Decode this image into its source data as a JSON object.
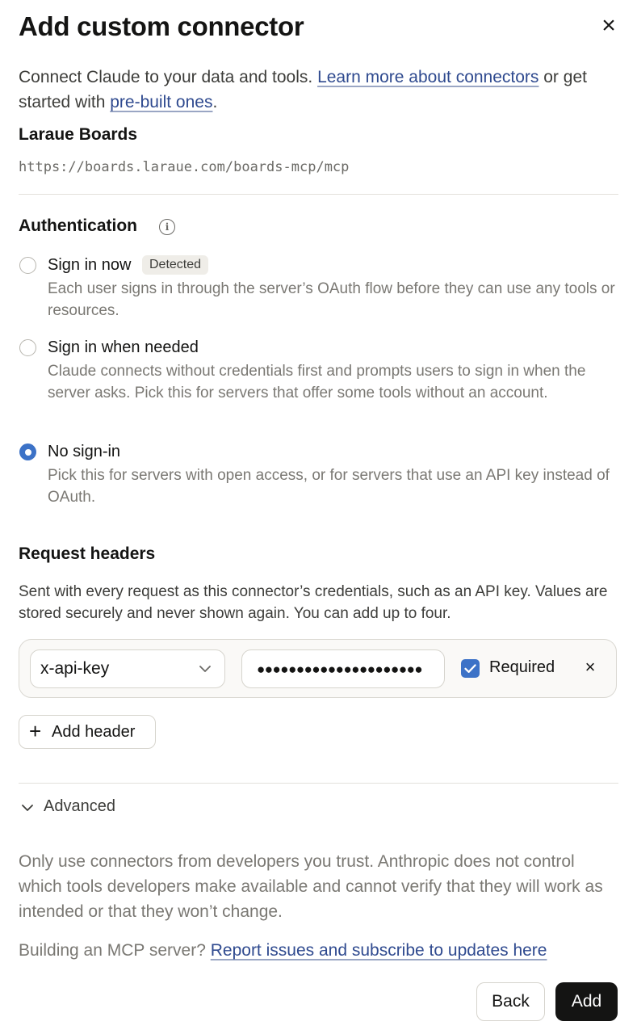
{
  "dialog": {
    "title": "Add custom connector",
    "close_icon": "close-icon"
  },
  "intro": {
    "text_before": "Connect Claude to your data and tools. ",
    "learn_more_link": "Learn more about connectors",
    "text_middle": " or get started with ",
    "prebuilt_link": "pre-built ones",
    "text_after": "."
  },
  "server": {
    "name": "Laraue Boards",
    "url": "https://boards.laraue.com/boards-mcp/mcp"
  },
  "authentication": {
    "title": "Authentication",
    "info_icon": "info-icon",
    "selected": "No sign-in",
    "options": [
      {
        "label": "Sign in now",
        "badge": "Detected",
        "description": "Each user signs in through the server’s OAuth flow before they can use any tools or resources.",
        "selected": false
      },
      {
        "label": "Sign in when needed",
        "description": "Claude connects without credentials first and prompts users to sign in when the server asks. Pick this for servers that offer some tools without an account.",
        "selected": false
      },
      {
        "label": "No sign-in",
        "description": "Pick this for servers with open access, or for servers that use an API key instead of OAuth.",
        "selected": true
      }
    ]
  },
  "request_headers": {
    "title": "Request headers",
    "description": "Sent with every request as this connector’s credentials, such as an API key. Values are stored securely and never shown again. You can add up to four.",
    "rows": [
      {
        "name": "x-api-key",
        "value_masked": "●●●●●●●●●●●●●●●●●●●●●",
        "required_label": "Required",
        "required": true
      }
    ],
    "add_button_label": "Add header"
  },
  "advanced": {
    "label": "Advanced",
    "expanded": false
  },
  "footer": {
    "warning": "Only use connectors from developers you trust. Anthropic does not control which tools developers make available and cannot verify that they will work as intended or that they won’t change.",
    "building_text": "Building an MCP server? ",
    "building_link": "Report issues and subscribe to updates here",
    "back_label": "Back",
    "add_label": "Add"
  },
  "colors": {
    "accent": "#3c72c7",
    "link": "#2f4a8f",
    "primary_button": "#141413",
    "muted_text": "#7a7873",
    "badge_bg": "#efede8"
  }
}
